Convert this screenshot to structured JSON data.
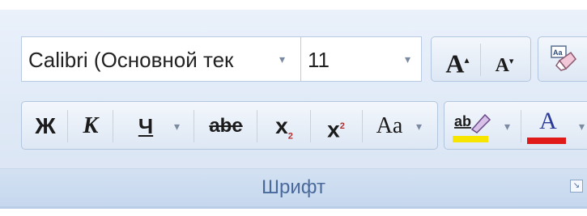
{
  "font": {
    "family_value": "Calibri (Основной тек",
    "size_value": "11"
  },
  "buttons": {
    "grow_font": "A",
    "shrink_font": "A",
    "bold": "Ж",
    "italic": "К",
    "underline": "Ч",
    "strikethrough": "abe",
    "subscript": "x",
    "subscript_mark": "2",
    "superscript": "x",
    "superscript_mark": "2",
    "change_case": "Aa",
    "highlight": "ab",
    "font_color": "A"
  },
  "colors": {
    "highlight_color": "#f7e500",
    "font_color": "#e01919"
  },
  "group": {
    "label": "Шрифт"
  },
  "icons": [
    "clear-formatting-icon",
    "dropdown-arrow-icon",
    "dialog-launcher-icon"
  ]
}
